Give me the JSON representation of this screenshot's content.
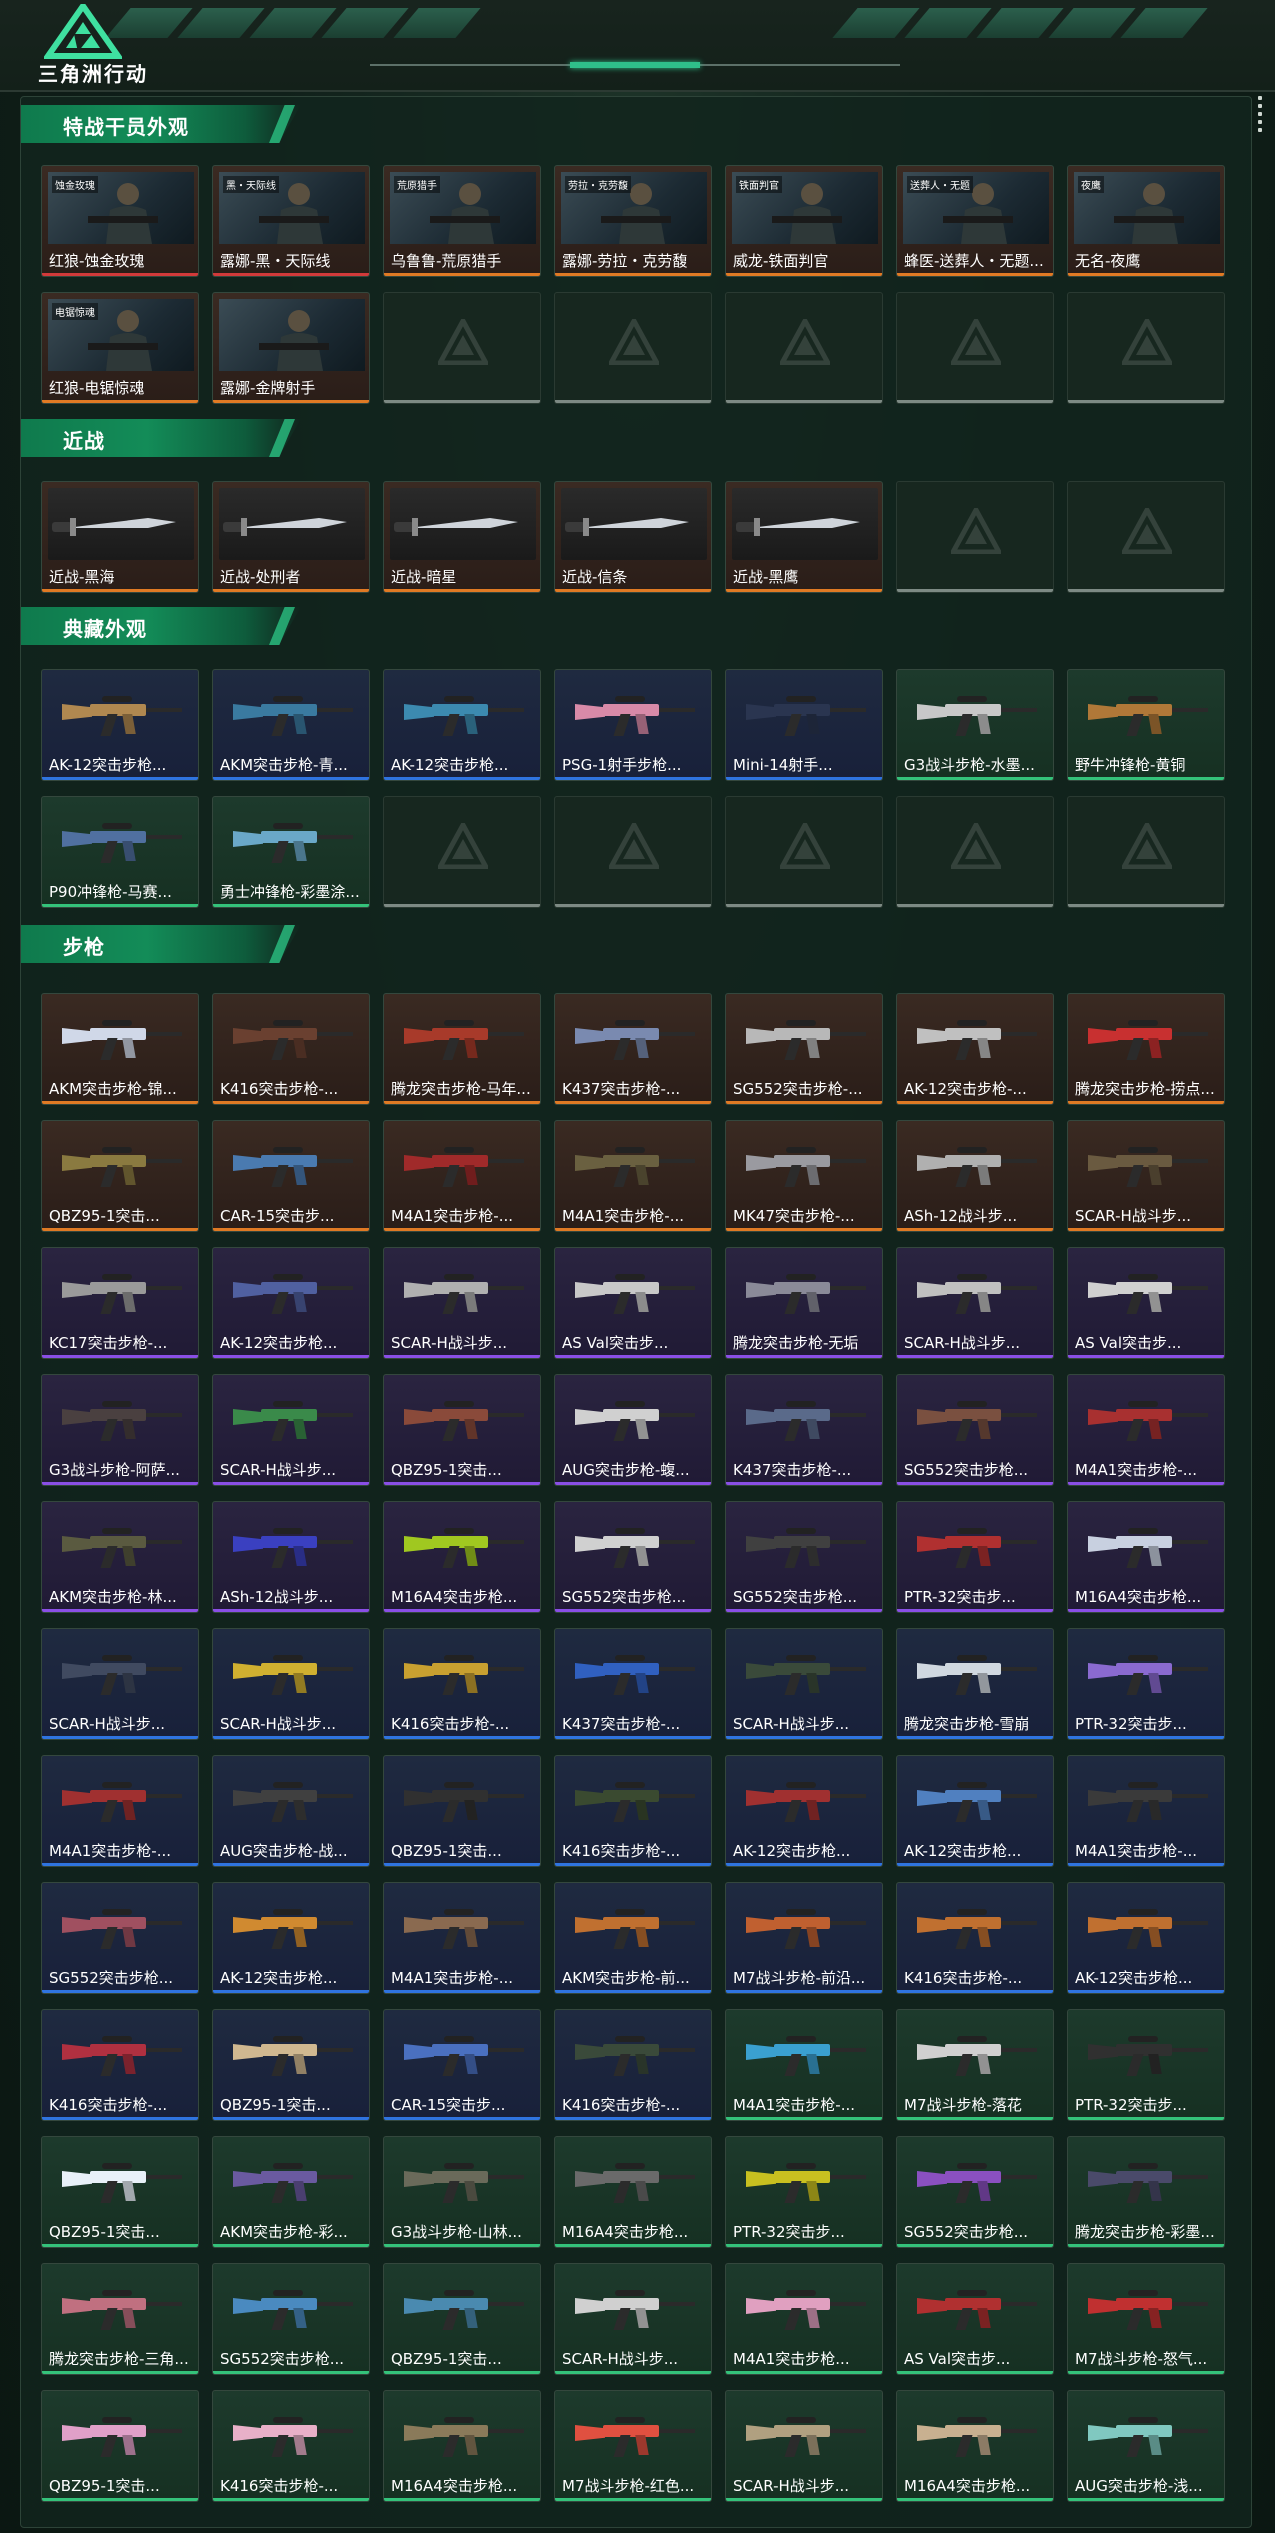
{
  "app": {
    "brand": "三角洲行动"
  },
  "colors": {
    "accent": "#2fd38f",
    "orange": "#e07a24",
    "blue": "#2f74e0",
    "purple": "#8a4fe6",
    "green": "#34c27a",
    "empty": "#7d8a84"
  },
  "sections": [
    {
      "title": "特战干员外观",
      "items": [
        {
          "name": "红狼-蚀金玫瑰",
          "rarity": "red",
          "kind": "operator",
          "badge": "蚀金玫瑰"
        },
        {
          "name": "露娜-黑・天际线",
          "rarity": "red",
          "kind": "operator",
          "badge": "黑・天际线"
        },
        {
          "name": "乌鲁鲁-荒原猎手",
          "rarity": "orange",
          "kind": "operator",
          "badge": "荒原猎手"
        },
        {
          "name": "露娜-劳拉・克劳馥",
          "rarity": "orange",
          "kind": "operator",
          "badge": "劳拉・克劳馥"
        },
        {
          "name": "威龙-铁面判官",
          "rarity": "orange",
          "kind": "operator",
          "badge": "铁面判官"
        },
        {
          "name": "蜂医-送葬人・无题...",
          "rarity": "orange",
          "kind": "operator",
          "badge": "送葬人・无题"
        },
        {
          "name": "无名-夜鹰",
          "rarity": "orange",
          "kind": "operator",
          "badge": "夜鹰"
        },
        {
          "name": "红狼-电锯惊魂",
          "rarity": "orange",
          "kind": "operator",
          "badge": "电锯惊魂"
        },
        {
          "name": "露娜-金牌射手",
          "rarity": "orange",
          "kind": "operator",
          "badge": ""
        },
        {
          "empty": true
        },
        {
          "empty": true
        },
        {
          "empty": true
        },
        {
          "empty": true
        },
        {
          "empty": true
        }
      ]
    },
    {
      "title": "近战",
      "items": [
        {
          "name": "近战-黑海",
          "rarity": "orange",
          "kind": "melee"
        },
        {
          "name": "近战-处刑者",
          "rarity": "orange",
          "kind": "melee"
        },
        {
          "name": "近战-暗星",
          "rarity": "orange",
          "kind": "melee"
        },
        {
          "name": "近战-信条",
          "rarity": "orange",
          "kind": "melee"
        },
        {
          "name": "近战-黑鹰",
          "rarity": "orange",
          "kind": "melee"
        },
        {
          "empty": true
        },
        {
          "empty": true
        }
      ]
    },
    {
      "title": "典藏外观",
      "items": [
        {
          "name": "AK-12突击步枪...",
          "rarity": "blue",
          "kind": "gun",
          "tone": "#b08850"
        },
        {
          "name": "AKM突击步枪-青...",
          "rarity": "blue",
          "kind": "gun",
          "tone": "#3a7aa0"
        },
        {
          "name": "AK-12突击步枪...",
          "rarity": "blue",
          "kind": "gun",
          "tone": "#3c8ab0"
        },
        {
          "name": "PSG-1射手步枪...",
          "rarity": "blue",
          "kind": "gun",
          "tone": "#d88aa8"
        },
        {
          "name": "Mini-14射手...",
          "rarity": "blue",
          "kind": "gun",
          "tone": "#2a3550"
        },
        {
          "name": "G3战斗步枪-水墨...",
          "rarity": "green",
          "kind": "gun",
          "tone": "#c8c8c8"
        },
        {
          "name": "野牛冲锋枪-黄铜",
          "rarity": "green",
          "kind": "gun",
          "tone": "#b07838"
        },
        {
          "name": "P90冲锋枪-马赛...",
          "rarity": "green",
          "kind": "gun",
          "tone": "#5070a0"
        },
        {
          "name": "勇士冲锋枪-彩墨涂...",
          "rarity": "green",
          "kind": "gun",
          "tone": "#6aa8c8"
        },
        {
          "empty": true
        },
        {
          "empty": true
        },
        {
          "empty": true
        },
        {
          "empty": true
        },
        {
          "empty": true
        }
      ]
    },
    {
      "title": "步枪",
      "items": [
        {
          "name": "AKM突击步枪-锦...",
          "rarity": "orange",
          "kind": "gun",
          "tone": "#d0d8e8"
        },
        {
          "name": "K416突击步枪-...",
          "rarity": "orange",
          "kind": "gun",
          "tone": "#6a4030"
        },
        {
          "name": "腾龙突击步枪-马年...",
          "rarity": "orange",
          "kind": "gun",
          "tone": "#a83a2a"
        },
        {
          "name": "K437突击步枪-...",
          "rarity": "orange",
          "kind": "gun",
          "tone": "#7a8ab0"
        },
        {
          "name": "SG552突击步枪-...",
          "rarity": "orange",
          "kind": "gun",
          "tone": "#b8b8b8"
        },
        {
          "name": "AK-12突击步枪-...",
          "rarity": "orange",
          "kind": "gun",
          "tone": "#c0c0c0"
        },
        {
          "name": "腾龙突击步枪-捞点...",
          "rarity": "orange",
          "kind": "gun",
          "tone": "#c83030"
        },
        {
          "name": "QBZ95-1突击...",
          "rarity": "orange",
          "kind": "gun",
          "tone": "#8a7a40"
        },
        {
          "name": "CAR-15突击步...",
          "rarity": "orange",
          "kind": "gun",
          "tone": "#4a7ab0"
        },
        {
          "name": "M4A1突击步枪-...",
          "rarity": "orange",
          "kind": "gun",
          "tone": "#a02a2a"
        },
        {
          "name": "M4A1突击步枪-...",
          "rarity": "orange",
          "kind": "gun",
          "tone": "#6a6040"
        },
        {
          "name": "MK47突击步枪-...",
          "rarity": "orange",
          "kind": "gun",
          "tone": "#9a9aa0"
        },
        {
          "name": "ASh-12战斗步...",
          "rarity": "orange",
          "kind": "gun",
          "tone": "#b0b0b0"
        },
        {
          "name": "SCAR-H战斗步...",
          "rarity": "orange",
          "kind": "gun",
          "tone": "#6a5a40"
        },
        {
          "name": "KC17突击步枪-...",
          "rarity": "purple",
          "kind": "gun",
          "tone": "#9a9a9a"
        },
        {
          "name": "AK-12突击步枪...",
          "rarity": "purple",
          "kind": "gun",
          "tone": "#5060a0"
        },
        {
          "name": "SCAR-H战斗步...",
          "rarity": "purple",
          "kind": "gun",
          "tone": "#b0b0b0"
        },
        {
          "name": "AS Val突击步...",
          "rarity": "purple",
          "kind": "gun",
          "tone": "#c8c8c8"
        },
        {
          "name": "腾龙突击步枪-无垢",
          "rarity": "purple",
          "kind": "gun",
          "tone": "#8a8a98"
        },
        {
          "name": "SCAR-H战斗步...",
          "rarity": "purple",
          "kind": "gun",
          "tone": "#c0c0c0"
        },
        {
          "name": "AS Val突击步...",
          "rarity": "purple",
          "kind": "gun",
          "tone": "#d0d0d0"
        },
        {
          "name": "G3战斗步枪-阿萨...",
          "rarity": "purple",
          "kind": "gun",
          "tone": "#4a4040"
        },
        {
          "name": "SCAR-H战斗步...",
          "rarity": "purple",
          "kind": "gun",
          "tone": "#3a8a4a"
        },
        {
          "name": "QBZ95-1突击...",
          "rarity": "purple",
          "kind": "gun",
          "tone": "#8a4a3a"
        },
        {
          "name": "AUG突击步枪-蝮...",
          "rarity": "purple",
          "kind": "gun",
          "tone": "#d0d0d0"
        },
        {
          "name": "K437突击步枪-...",
          "rarity": "purple",
          "kind": "gun",
          "tone": "#5a6a8a"
        },
        {
          "name": "SG552突击步枪...",
          "rarity": "purple",
          "kind": "gun",
          "tone": "#7a5040"
        },
        {
          "name": "M4A1突击步枪-...",
          "rarity": "purple",
          "kind": "gun",
          "tone": "#a83030"
        },
        {
          "name": "AKM突击步枪-林...",
          "rarity": "purple",
          "kind": "gun",
          "tone": "#5a5a40"
        },
        {
          "name": "ASh-12战斗步...",
          "rarity": "purple",
          "kind": "gun",
          "tone": "#3a40c0"
        },
        {
          "name": "M16A4突击步枪...",
          "rarity": "purple",
          "kind": "gun",
          "tone": "#a0c820"
        },
        {
          "name": "SG552突击步枪...",
          "rarity": "purple",
          "kind": "gun",
          "tone": "#d0d0d0"
        },
        {
          "name": "SG552突击步枪...",
          "rarity": "purple",
          "kind": "gun",
          "tone": "#404040"
        },
        {
          "name": "PTR-32突击步...",
          "rarity": "purple",
          "kind": "gun",
          "tone": "#b03030"
        },
        {
          "name": "M16A4突击步枪...",
          "rarity": "purple",
          "kind": "gun",
          "tone": "#c8d0e0"
        },
        {
          "name": "SCAR-H战斗步...",
          "rarity": "blue",
          "kind": "gun",
          "tone": "#404a60"
        },
        {
          "name": "SCAR-H战斗步...",
          "rarity": "blue",
          "kind": "gun",
          "tone": "#d0b030"
        },
        {
          "name": "K416突击步枪-...",
          "rarity": "blue",
          "kind": "gun",
          "tone": "#c8a030"
        },
        {
          "name": "K437突击步枪-...",
          "rarity": "blue",
          "kind": "gun",
          "tone": "#3060c0"
        },
        {
          "name": "SCAR-H战斗步...",
          "rarity": "blue",
          "kind": "gun",
          "tone": "#3a4a3a"
        },
        {
          "name": "腾龙突击步枪-雪崩",
          "rarity": "blue",
          "kind": "gun",
          "tone": "#d0d8e0"
        },
        {
          "name": "PTR-32突击步...",
          "rarity": "blue",
          "kind": "gun",
          "tone": "#8a6ad0"
        },
        {
          "name": "M4A1突击步枪-...",
          "rarity": "blue",
          "kind": "gun",
          "tone": "#a03030"
        },
        {
          "name": "AUG突击步枪-战...",
          "rarity": "blue",
          "kind": "gun",
          "tone": "#404040"
        },
        {
          "name": "QBZ95-1突击...",
          "rarity": "blue",
          "kind": "gun",
          "tone": "#303030"
        },
        {
          "name": "K416突击步枪-...",
          "rarity": "blue",
          "kind": "gun",
          "tone": "#3a4a30"
        },
        {
          "name": "AK-12突击步枪...",
          "rarity": "blue",
          "kind": "gun",
          "tone": "#a03030"
        },
        {
          "name": "AK-12突击步枪...",
          "rarity": "blue",
          "kind": "gun",
          "tone": "#5080c0"
        },
        {
          "name": "M4A1突击步枪-...",
          "rarity": "blue",
          "kind": "gun",
          "tone": "#3a3a3a"
        },
        {
          "name": "SG552突击步枪...",
          "rarity": "blue",
          "kind": "gun",
          "tone": "#a05060"
        },
        {
          "name": "AK-12突击步枪...",
          "rarity": "blue",
          "kind": "gun",
          "tone": "#d08a30"
        },
        {
          "name": "M4A1突击步枪-...",
          "rarity": "blue",
          "kind": "gun",
          "tone": "#8a6a50"
        },
        {
          "name": "AKM突击步枪-前...",
          "rarity": "blue",
          "kind": "gun",
          "tone": "#c07030"
        },
        {
          "name": "M7战斗步枪-前沿...",
          "rarity": "blue",
          "kind": "gun",
          "tone": "#c06030"
        },
        {
          "name": "K416突击步枪-...",
          "rarity": "blue",
          "kind": "gun",
          "tone": "#c07030"
        },
        {
          "name": "AK-12突击步枪...",
          "rarity": "blue",
          "kind": "gun",
          "tone": "#c07030"
        },
        {
          "name": "K416突击步枪-...",
          "rarity": "blue",
          "kind": "gun",
          "tone": "#b03040"
        },
        {
          "name": "QBZ95-1突击...",
          "rarity": "blue",
          "kind": "gun",
          "tone": "#d0b890"
        },
        {
          "name": "CAR-15突击步...",
          "rarity": "blue",
          "kind": "gun",
          "tone": "#4a70c0"
        },
        {
          "name": "K416突击步枪-...",
          "rarity": "blue",
          "kind": "gun",
          "tone": "#3a4a3a"
        },
        {
          "name": "M4A1突击步枪-...",
          "rarity": "green",
          "kind": "gun",
          "tone": "#3aa0d0"
        },
        {
          "name": "M7战斗步枪-落花",
          "rarity": "green",
          "kind": "gun",
          "tone": "#d0d0d0"
        },
        {
          "name": "PTR-32突击步...",
          "rarity": "green",
          "kind": "gun",
          "tone": "#303030"
        },
        {
          "name": "QBZ95-1突击...",
          "rarity": "green",
          "kind": "gun",
          "tone": "#e8f0f8"
        },
        {
          "name": "AKM突击步枪-彩...",
          "rarity": "green",
          "kind": "gun",
          "tone": "#6a5aa0"
        },
        {
          "name": "G3战斗步枪-山林...",
          "rarity": "green",
          "kind": "gun",
          "tone": "#6a6a5a"
        },
        {
          "name": "M16A4突击步枪...",
          "rarity": "green",
          "kind": "gun",
          "tone": "#6a6a6a"
        },
        {
          "name": "PTR-32突击步...",
          "rarity": "green",
          "kind": "gun",
          "tone": "#c8c020"
        },
        {
          "name": "SG552突击步枪...",
          "rarity": "green",
          "kind": "gun",
          "tone": "#8a50c0"
        },
        {
          "name": "腾龙突击步枪-彩墨...",
          "rarity": "green",
          "kind": "gun",
          "tone": "#4a4a6a"
        },
        {
          "name": "腾龙突击步枪-三角...",
          "rarity": "green",
          "kind": "gun",
          "tone": "#c07080"
        },
        {
          "name": "SG552突击步枪...",
          "rarity": "green",
          "kind": "gun",
          "tone": "#4a8ac0"
        },
        {
          "name": "QBZ95-1突击...",
          "rarity": "green",
          "kind": "gun",
          "tone": "#4a8ab0"
        },
        {
          "name": "SCAR-H战斗步...",
          "rarity": "green",
          "kind": "gun",
          "tone": "#d0d0d0"
        },
        {
          "name": "M4A1突击步枪...",
          "rarity": "green",
          "kind": "gun",
          "tone": "#e0a0c0"
        },
        {
          "name": "AS Val突击步...",
          "rarity": "green",
          "kind": "gun",
          "tone": "#b03030"
        },
        {
          "name": "M7战斗步枪-怒气...",
          "rarity": "green",
          "kind": "gun",
          "tone": "#c03030"
        },
        {
          "name": "QBZ95-1突击...",
          "rarity": "green",
          "kind": "gun",
          "tone": "#e0a0c8"
        },
        {
          "name": "K416突击步枪-...",
          "rarity": "green",
          "kind": "gun",
          "tone": "#e8b0c8"
        },
        {
          "name": "M16A4突击步枪...",
          "rarity": "green",
          "kind": "gun",
          "tone": "#8a7a5a"
        },
        {
          "name": "M7战斗步枪-红色...",
          "rarity": "green",
          "kind": "gun",
          "tone": "#e05040"
        },
        {
          "name": "SCAR-H战斗步...",
          "rarity": "green",
          "kind": "gun",
          "tone": "#b0a080"
        },
        {
          "name": "M16A4突击步枪...",
          "rarity": "green",
          "kind": "gun",
          "tone": "#c8b090"
        },
        {
          "name": "AUG突击步枪-浅...",
          "rarity": "green",
          "kind": "gun",
          "tone": "#80c8c0"
        }
      ]
    }
  ]
}
